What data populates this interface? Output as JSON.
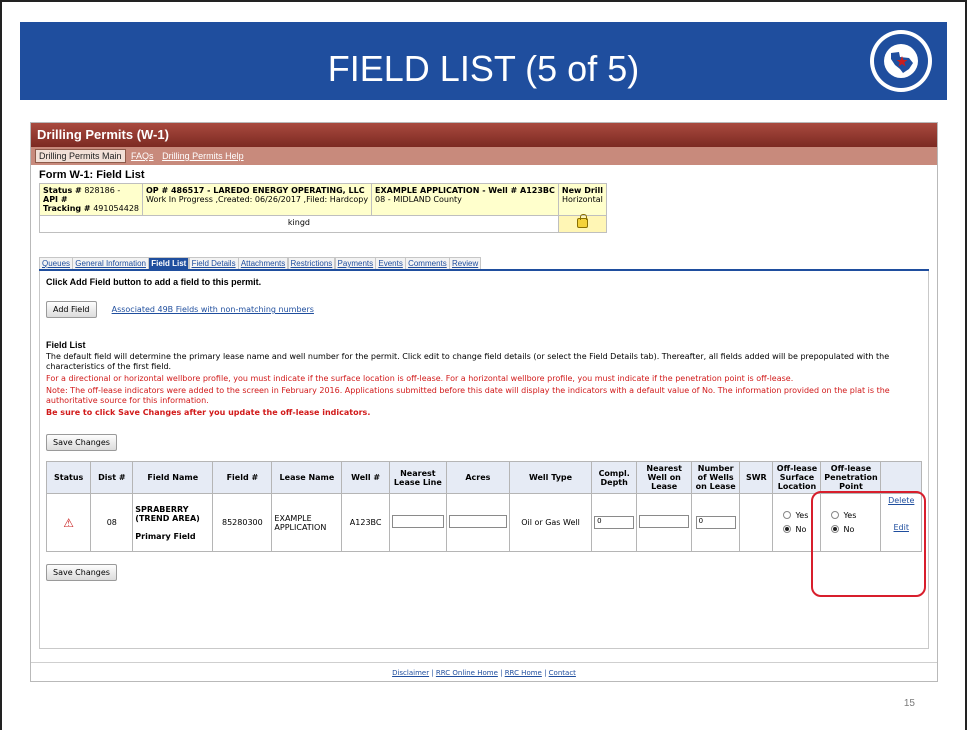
{
  "slide": {
    "title": "FIELD LIST (5 of 5)",
    "page_number": "15",
    "seal_label": "RAILROAD COMMISSION OF TEXAS",
    "banner_color": "#1f4e9e"
  },
  "app": {
    "header": "Drilling Permits (W-1)",
    "nav": {
      "main": "Drilling Permits Main",
      "faqs": "FAQs",
      "help": "Drilling Permits Help"
    },
    "form_title": "Form W-1: Field List",
    "info": {
      "status_label": "Status #",
      "status_value": "828186",
      "api_label": "API #",
      "tracking_label": "Tracking #",
      "tracking_value": "491054428",
      "op_line": "OP # 486517  -  LAREDO ENERGY OPERATING, LLC",
      "status_line": "Work In Progress ,Created: 06/26/2017 ,Filed: Hardcopy",
      "app_line": "EXAMPLE APPLICATION - Well # A123BC",
      "county_line": "08 - MIDLAND County",
      "type_line1": "New Drill",
      "type_line2": "Horizontal",
      "user": "kingd"
    },
    "tabs": [
      "Queues",
      "General Information",
      "Field List",
      "Field Details",
      "Attachments",
      "Restrictions",
      "Payments",
      "Events",
      "Comments",
      "Review"
    ],
    "active_tab": "Field List",
    "instruction": "Click Add Field button to add a field to this permit.",
    "add_field_button": "Add Field",
    "associated_link": "Associated 49B Fields with non-matching numbers",
    "section_title": "Field List",
    "para1": "The default field will determine the primary lease name and well number for the permit. Click edit to change field details (or select the Field Details tab). Thereafter, all fields added will be prepopulated with the characteristics of the first field.",
    "para2": "For a directional or horizontal wellbore profile, you must indicate if the surface location is off-lease. For a horizontal wellbore profile, you must indicate if the penetration point is off-lease.",
    "para3": "Note: The off-lease indicators were added to the screen in February 2016. Applications submitted before this date will display the indicators with a default value of No. The information provided on the plat is the authoritative source for this information.",
    "para4": "Be sure to click Save Changes after you update the off-lease indicators.",
    "save_button": "Save Changes",
    "table": {
      "headers": [
        "Status",
        "Dist #",
        "Field Name",
        "Field #",
        "Lease Name",
        "Well #",
        "Nearest Lease Line",
        "Acres",
        "Well Type",
        "Compl. Depth",
        "Nearest Well on Lease",
        "Number of Wells on Lease",
        "SWR",
        "Off-lease Surface Location",
        "Off-lease Penetration Point",
        ""
      ],
      "row": {
        "dist": "08",
        "field_name": "SPRABERRY (TREND AREA)",
        "field_note": "Primary Field",
        "field_num": "85280300",
        "lease_name": "EXAMPLE APPLICATION",
        "well_num": "A123BC",
        "well_type": "Oil or Gas Well",
        "compl_depth": "0",
        "num_wells": "0",
        "yes": "Yes",
        "no": "No",
        "delete": "Delete",
        "edit": "Edit"
      }
    },
    "footer": {
      "disclaimer": "Disclaimer",
      "online_home": "RRC Online Home",
      "home": "RRC Home",
      "contact": "Contact"
    }
  }
}
